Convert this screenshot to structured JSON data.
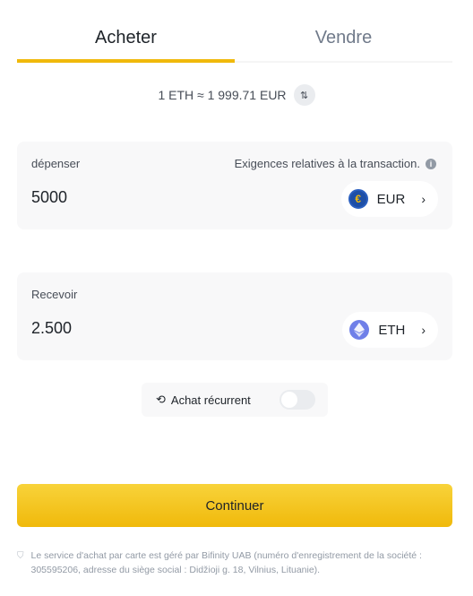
{
  "tabs": {
    "buy": "Acheter",
    "sell": "Vendre"
  },
  "rate": {
    "text": "1 ETH ≈ 1 999.71 EUR",
    "swap_icon": "swap-vertical-icon"
  },
  "spend": {
    "label": "dépenser",
    "hint": "Exigences relatives à la transaction.",
    "amount": "5000",
    "currency": "EUR",
    "coin_symbol": "€"
  },
  "receive": {
    "label": "Recevoir",
    "amount": "2.500",
    "currency": "ETH"
  },
  "recurring": {
    "label": "Achat récurrent",
    "enabled": false
  },
  "continue_label": "Continuer",
  "disclaimer": "Le service d'achat par carte est géré par Bifinity UAB (numéro d'enregistrement de la société : 305595206, adresse du siège social : Didžioji g. 18, Vilnius, Lituanie).",
  "colors": {
    "accent": "#f0b90b",
    "card_bg": "#f8f8f9",
    "text_primary": "#1e2329",
    "text_secondary": "#707a8a"
  }
}
